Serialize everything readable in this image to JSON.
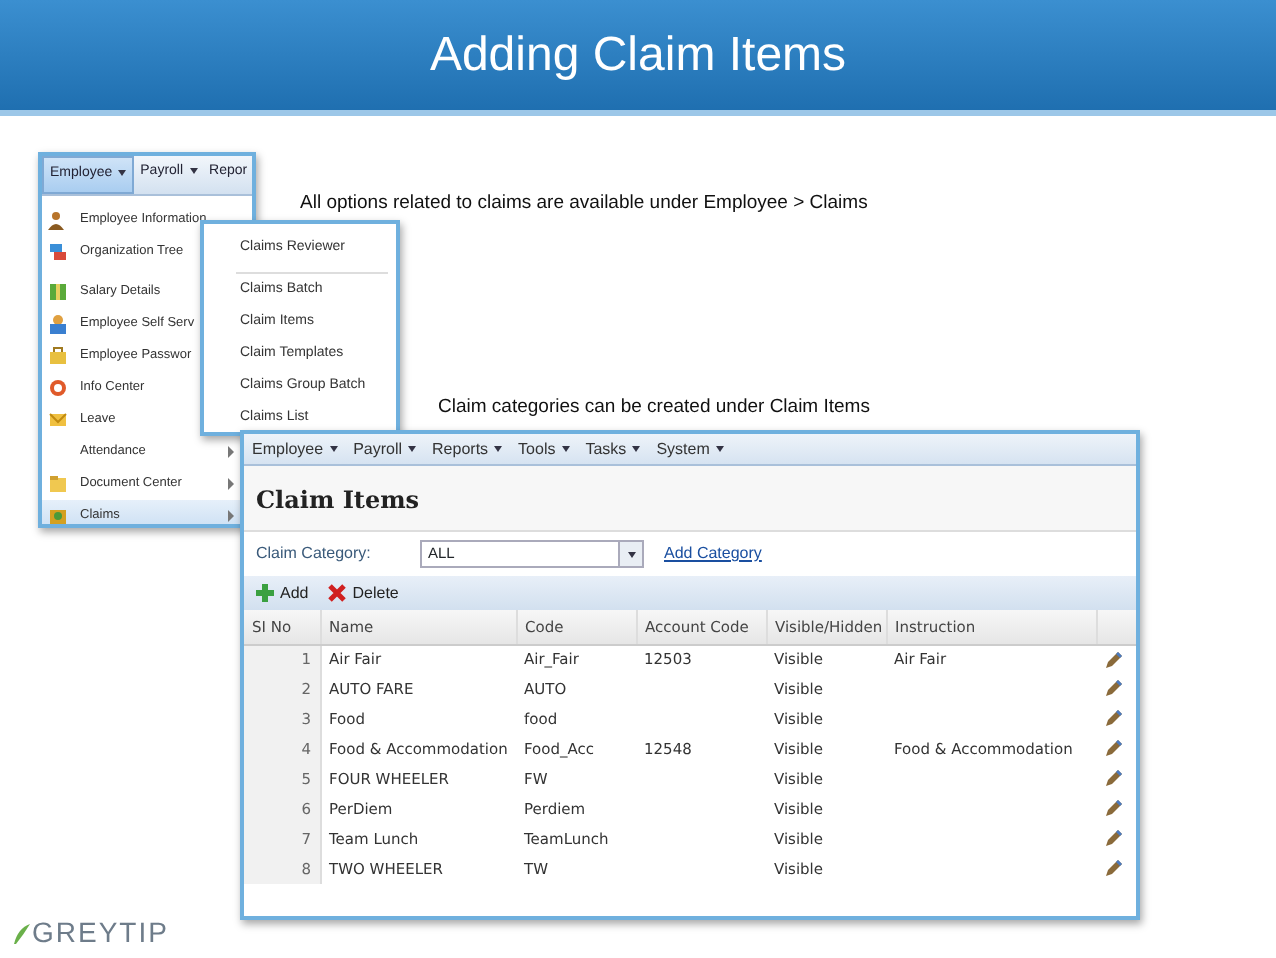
{
  "slide": {
    "title": "Adding Claim Items",
    "captions": [
      "All options related to claims are available under Employee > Claims",
      "Claim categories can be created under Claim Items"
    ],
    "logo": "GREYTIP"
  },
  "menu_screenshot": {
    "menubar": [
      {
        "label": "Employee",
        "selected": true
      },
      {
        "label": "Payroll",
        "selected": false
      },
      {
        "label": "Repor",
        "selected": false
      }
    ],
    "items": [
      {
        "label": "Employee Information",
        "kind": "iconed",
        "submenu": false,
        "selected": false
      },
      {
        "label": "Organization Tree",
        "kind": "iconed",
        "submenu": false,
        "selected": false
      },
      {
        "label": "Salary Details",
        "kind": "iconed",
        "submenu": false,
        "selected": false
      },
      {
        "label": "Employee Self Serv",
        "kind": "iconed",
        "submenu": false,
        "selected": false
      },
      {
        "label": "Employee Passwor",
        "kind": "iconed",
        "submenu": false,
        "selected": false
      },
      {
        "label": "Info Center",
        "kind": "iconed",
        "submenu": false,
        "selected": false
      },
      {
        "label": "Leave",
        "kind": "iconed",
        "submenu": false,
        "selected": false
      },
      {
        "label": "Attendance",
        "kind": "plain",
        "submenu": true,
        "selected": false
      },
      {
        "label": "Document Center",
        "kind": "iconed",
        "submenu": true,
        "selected": false
      },
      {
        "label": "Claims",
        "kind": "iconed",
        "submenu": true,
        "selected": true
      }
    ],
    "submenu": [
      {
        "label": "Claims Reviewer",
        "kind": "entry"
      },
      {
        "kind": "divider"
      },
      {
        "label": "Claims Batch",
        "kind": "entry"
      },
      {
        "label": "Claim Items",
        "kind": "entry"
      },
      {
        "label": "Claim Templates",
        "kind": "entry"
      },
      {
        "label": "Claims Group Batch",
        "kind": "entry"
      },
      {
        "label": "Claims List",
        "kind": "entry"
      }
    ]
  },
  "claim_screen": {
    "menubar": [
      "Employee",
      "Payroll",
      "Reports",
      "Tools",
      "Tasks",
      "System"
    ],
    "heading": "Claim Items",
    "filter": {
      "label": "Claim Category:",
      "value": "ALL",
      "link": "Add Category"
    },
    "toolbar": [
      {
        "label": "Add",
        "kind": "add"
      },
      {
        "label": "Delete",
        "kind": "delete"
      }
    ],
    "table": {
      "columns": [
        "SI No",
        "Name",
        "Code",
        "Account Code",
        "Visible/Hidden",
        "Instruction"
      ],
      "rows": [
        [
          "1",
          "Air Fair",
          "Air_Fair",
          "12503",
          "Visible",
          "Air Fair"
        ],
        [
          "2",
          "AUTO FARE",
          "AUTO",
          "",
          "Visible",
          ""
        ],
        [
          "3",
          "Food",
          "food",
          "",
          "Visible",
          ""
        ],
        [
          "4",
          "Food & Accommodation",
          "Food_Acc",
          "12548",
          "Visible",
          "Food & Accommodation"
        ],
        [
          "5",
          "FOUR WHEELER",
          "FW",
          "",
          "Visible",
          ""
        ],
        [
          "6",
          "PerDiem",
          "Perdiem",
          "",
          "Visible",
          ""
        ],
        [
          "7",
          "Team Lunch",
          "TeamLunch",
          "",
          "Visible",
          ""
        ],
        [
          "8",
          "TWO WHEELER",
          "TW",
          "",
          "Visible",
          ""
        ]
      ]
    }
  }
}
